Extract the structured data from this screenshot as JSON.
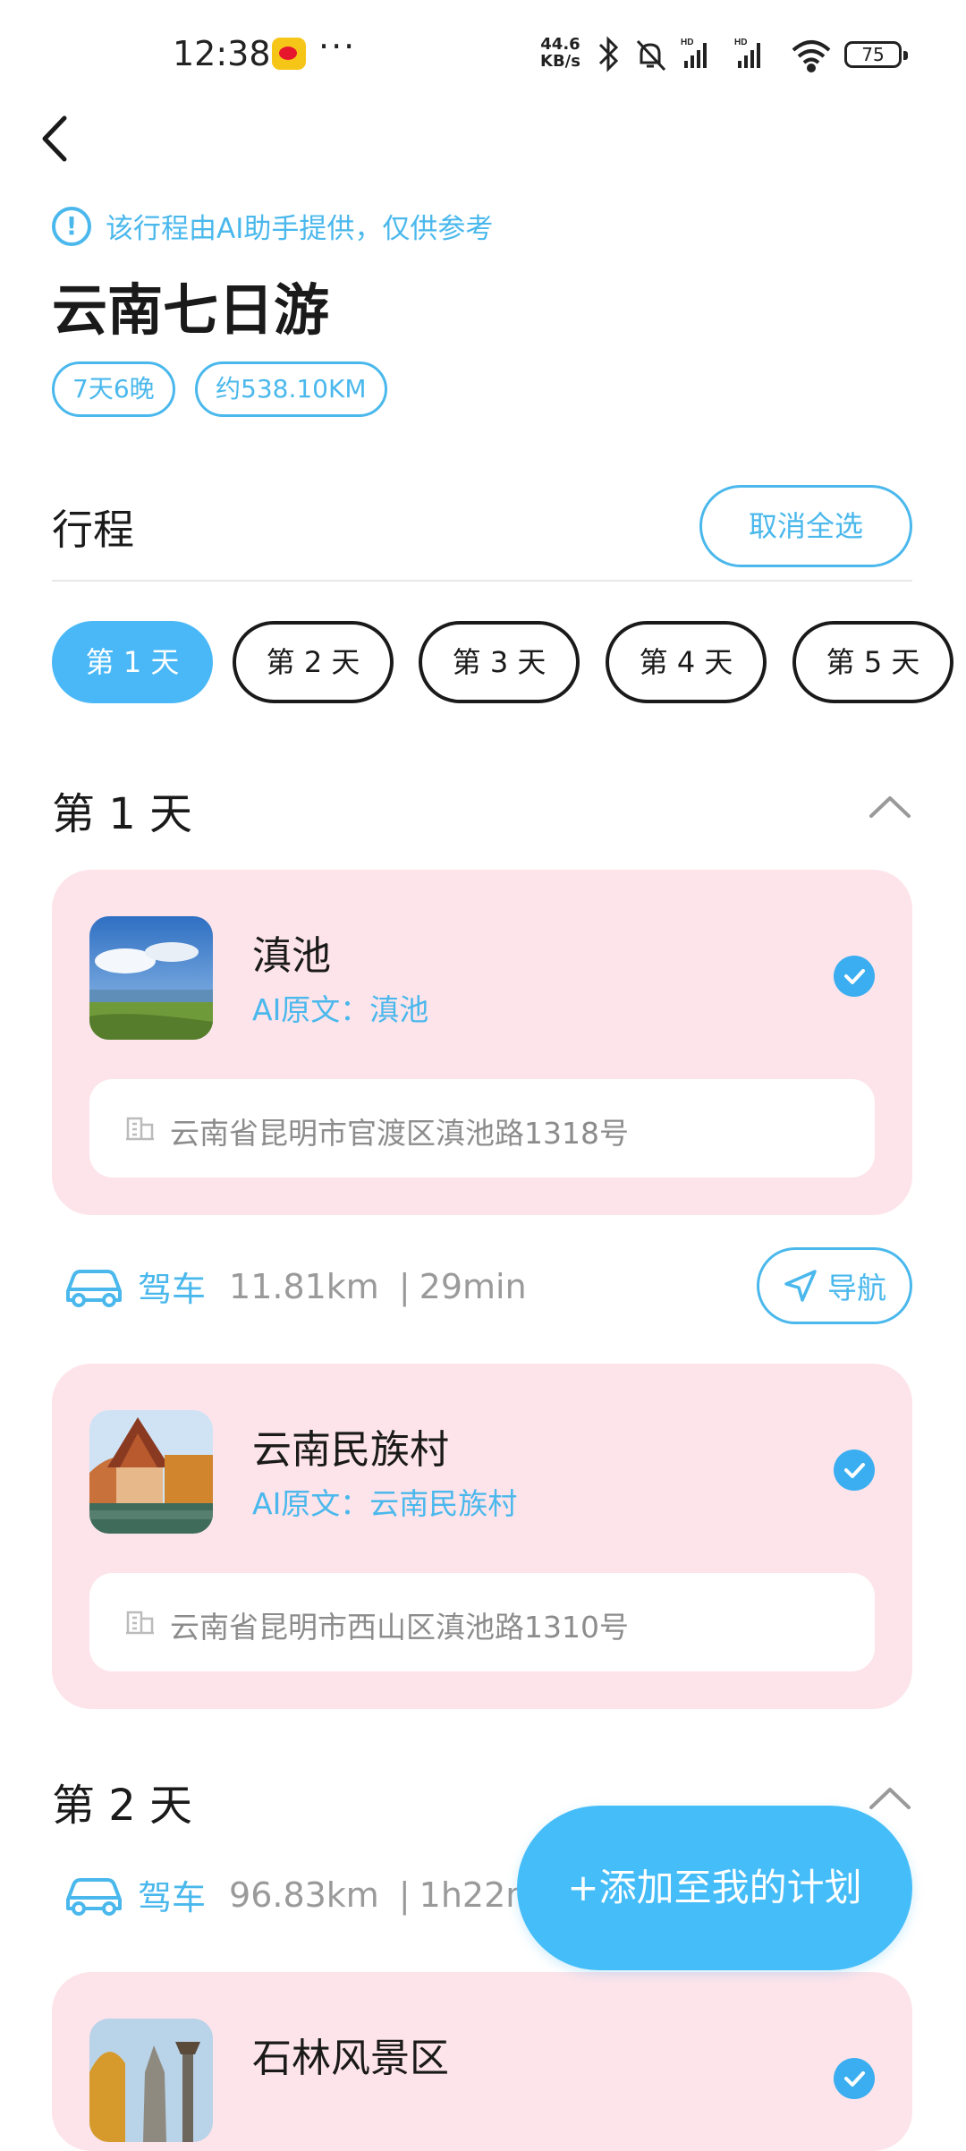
{
  "status_bar": {
    "time": "12:38",
    "dots": "···",
    "speed_value": "44.6",
    "speed_unit": "KB/s",
    "battery": "75"
  },
  "notice": {
    "text": "该行程由AI助手提供，仅供参考"
  },
  "trip": {
    "title": "云南七日游",
    "tags": [
      "7天6晚",
      "约538.10KM"
    ]
  },
  "itinerary": {
    "title": "行程",
    "cancel_all": "取消全选"
  },
  "day_tabs": [
    "第 1 天",
    "第 2 天",
    "第 3 天",
    "第 4 天",
    "第 5 天"
  ],
  "days": [
    {
      "title": "第 1 天",
      "places": [
        {
          "name": "滇池",
          "ai_text": "AI原文：滇池",
          "address": "云南省昆明市官渡区滇池路1318号"
        },
        {
          "name": "云南民族村",
          "ai_text": "AI原文：云南民族村",
          "address": "云南省昆明市西山区滇池路1310号"
        }
      ],
      "drive": {
        "label": "驾车",
        "distance": "11.81km",
        "time": "29min",
        "nav_label": "导航"
      }
    },
    {
      "title": "第 2 天",
      "drive": {
        "label": "驾车",
        "distance": "96.83km",
        "time": "1h22min"
      },
      "places": [
        {
          "name": "石林风景区"
        }
      ]
    }
  ],
  "fab": {
    "label": "+添加至我的计划"
  },
  "colors": {
    "accent": "#4ab8ec",
    "card_bg": "#fde4ea",
    "active_tab": "#4ab8f7"
  }
}
